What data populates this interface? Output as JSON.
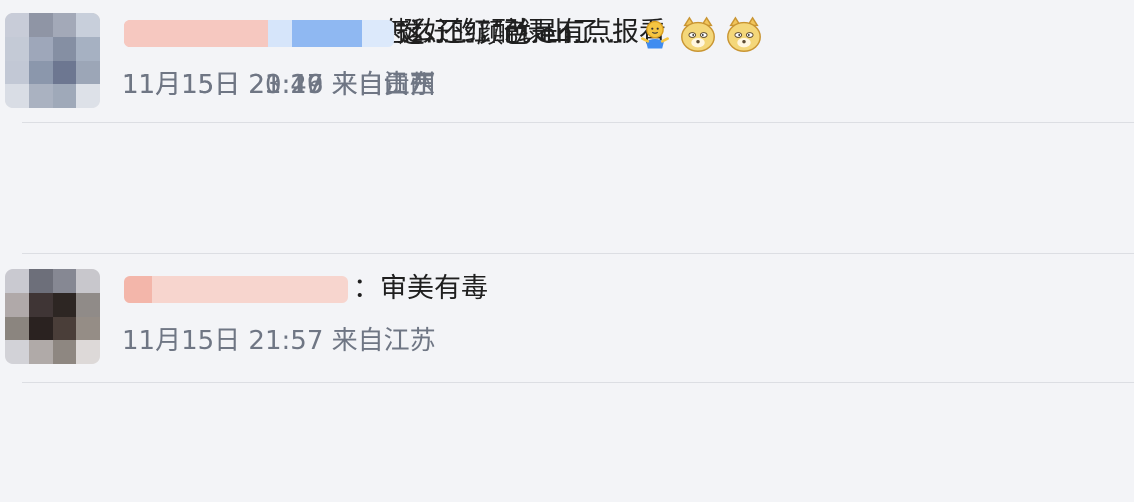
{
  "comments": [
    {
      "text": "怎么还红配绿山了",
      "time": "11月15日 23:49",
      "location": "来自山东"
    },
    {
      "text": "：审美有毒",
      "time": "11月15日 21:57",
      "location": "来自江苏"
    },
    {
      "text": "挺好的，就是有点报看",
      "time": "11月15日 21:16",
      "location": "来自江西"
    },
    {
      "text": "这......颜色 en......",
      "time": "11月15日 20:27",
      "location": "来自贵州",
      "emojis": [
        "shrug-emoji",
        "doge-emoji",
        "doge-emoji"
      ]
    }
  ],
  "colors": {
    "background": "#f3f4f7",
    "text": "#1f1f1f",
    "meta": "#6f7684",
    "divider": "#dcdee3",
    "blur_pink": "#f7c9c2",
    "blur_blue": "#8db6f1"
  }
}
